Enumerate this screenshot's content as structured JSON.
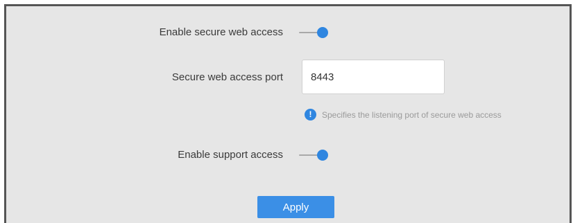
{
  "settings": {
    "secure_web_access": {
      "label": "Enable secure web access",
      "enabled": true
    },
    "port": {
      "label": "Secure web access port",
      "value": "8443",
      "hint": "Specifies the listening port of secure web access"
    },
    "support_access": {
      "label": "Enable support access",
      "enabled": true
    }
  },
  "icons": {
    "hint_icon": "info-icon"
  },
  "actions": {
    "apply_label": "Apply"
  },
  "colors": {
    "accent": "#2f86e0",
    "panel_background": "#e6e6e6"
  }
}
